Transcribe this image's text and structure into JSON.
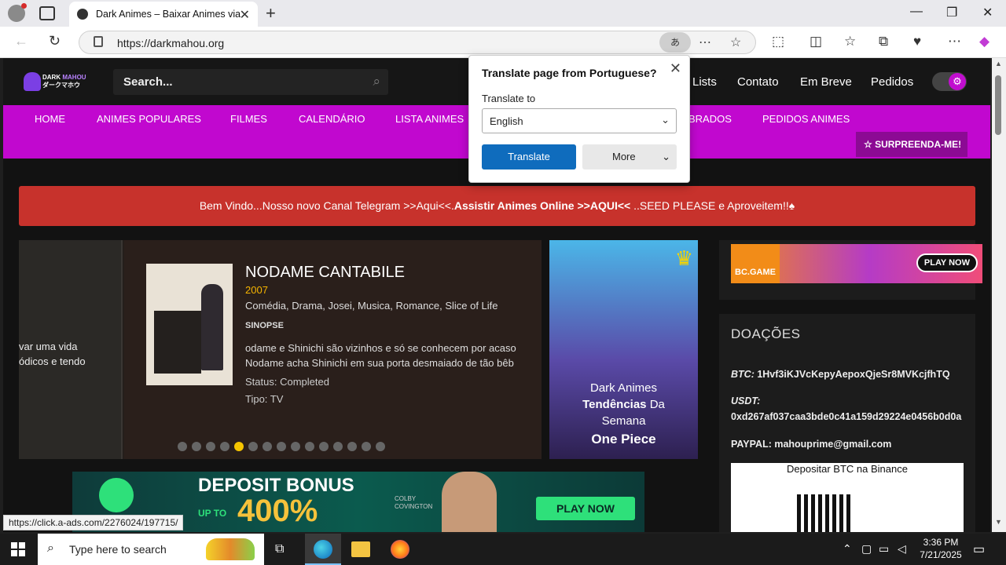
{
  "browser": {
    "tab_title": "Dark Animes – Baixar Animes via T",
    "tab_close": "✕",
    "new_tab": "+",
    "url": "https://darkmahou.org",
    "translate_icon": "あ",
    "window_controls": [
      "—",
      "❐",
      "✕"
    ]
  },
  "site": {
    "logo_text_a": "DARK",
    "logo_text_b": "MAHOU",
    "logo_text_c": "ダークマホウ",
    "search_placeholder": "Search...",
    "header_links": [
      "Lists",
      "Contato",
      "Em Breve",
      "Pedidos"
    ],
    "menu": [
      "HOME",
      "ANIMES POPULARES",
      "FILMES",
      "CALENDÁRIO",
      "LISTA ANIMES",
      "BRADOS",
      "PEDIDOS ANIMES"
    ],
    "surprise_label": "SURPREENDA-ME!",
    "notice_pre": "Bem Vindo...Nosso novo Canal Telegram >>Aqui<<.",
    "notice_bold": "Assistir Animes Online >>AQUI<<",
    "notice_post": " ..SEED PLEASE e Aproveitem!!♠"
  },
  "slider": {
    "left_text_1": "var uma vida",
    "left_text_2": "ódicos e tendo",
    "title": "NODAME CANTABILE",
    "year": "2007",
    "genres": "Comédia, Drama, Josei, Musica, Romance, Slice of Life",
    "synopsis_heading": "SINOPSE",
    "synopsis_1": "odame e Shinichi são vizinhos e só se conhecem por acaso",
    "synopsis_2": "Nodame acha Shinichi em sua porta desmaiado de tão bêb",
    "status": "Status: Completed",
    "type": "Tipo: TV",
    "dot_count": 15,
    "active_dot": 4
  },
  "promo": {
    "line1": "Dark Animes",
    "line2_bold": "Tendências",
    "line2_rest": " Da",
    "line3": "Semana",
    "sub": "One Piece"
  },
  "ads": {
    "bc_label": "BC.GAME",
    "bc_play": "PLAY NOW",
    "deposit_title": "DEPOSIT BONUS",
    "deposit_upto": "UP TO",
    "deposit_amount": "400%",
    "deposit_small_1": "COLBY",
    "deposit_small_2": "COVINGTON",
    "deposit_play": "PLAY NOW"
  },
  "donations": {
    "heading": "DOAÇÕES",
    "btc_label": "BTC:",
    "btc_value": " 1Hvf3iKJVcKepyAepoxQjeSr8MVKcjfhTQ",
    "usdt_label": "USDT:",
    "usdt_value": "0xd267af037caa3bde0c41a159d29224e0456b0d0a",
    "paypal": "PAYPAL: mahouprime@gmail.com",
    "qr_title": "Depositar BTC na Binance"
  },
  "status_url": "https://click.a-ads.com/2276024/197715/",
  "translate_popup": {
    "title": "Translate page from Portuguese?",
    "label": "Translate to",
    "selected": "English",
    "translate_btn": "Translate",
    "more_btn": "More"
  },
  "taskbar": {
    "search_text": "Type here to search",
    "time": "3:36 PM",
    "date": "7/21/2025"
  }
}
